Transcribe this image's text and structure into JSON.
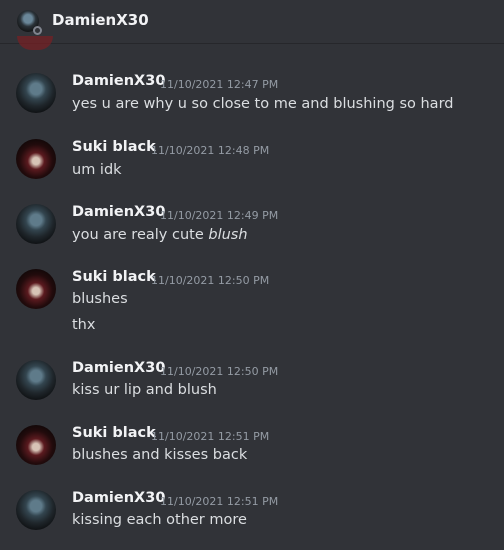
{
  "header": {
    "title": "DamienX30",
    "avatar_icon": "user-avatar-icon",
    "status": "offline"
  },
  "messages": [
    {
      "author": "DamienX30",
      "time": "11/10/2021 12:47 PM",
      "lines": [
        {
          "text": "yes u are why u so close to me and blushing so hard"
        }
      ]
    },
    {
      "author": "Suki black",
      "time": "11/10/2021 12:48 PM",
      "lines": [
        {
          "text": "um idk"
        }
      ]
    },
    {
      "author": "DamienX30",
      "time": "11/10/2021 12:49 PM",
      "lines": [
        {
          "text": "you are realy cute ",
          "italic_suffix": "blush"
        }
      ]
    },
    {
      "author": "Suki black",
      "time": "11/10/2021 12:50 PM",
      "lines": [
        {
          "italic": "blushes"
        },
        {
          "text": "thx"
        }
      ]
    },
    {
      "author": "DamienX30",
      "time": "11/10/2021 12:50 PM",
      "lines": [
        {
          "italic": "kiss ur lip and blush"
        }
      ]
    },
    {
      "author": "Suki black",
      "time": "11/10/2021 12:51 PM",
      "lines": [
        {
          "italic": "blushes and kisses back"
        }
      ]
    },
    {
      "author": "DamienX30",
      "time": "11/10/2021 12:51 PM",
      "lines": [
        {
          "italic": "kissing each other more"
        }
      ]
    }
  ]
}
